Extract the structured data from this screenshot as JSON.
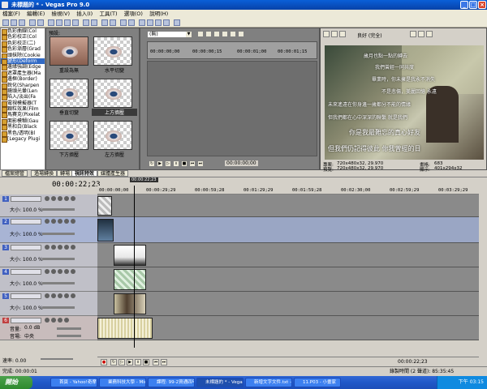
{
  "window": {
    "title": "未標題的 * - Vegas Pro 9.0"
  },
  "menu": [
    "檔案(F)",
    "編輯(E)",
    "檢視(V)",
    "插入(I)",
    "工具(T)",
    "選項(O)",
    "說明(H)"
  ],
  "fx_list": {
    "items": [
      "色彩曲線(Col",
      "色彩校正(Col",
      "色彩校正(二)",
      "色彩漸層(Grad",
      "頭抹除(Cookie",
      "變形(Deform",
      "邊緣強調(Edge",
      "遮罩產生器(Ma",
      "邊框(Border)",
      "銳化(Sharpen",
      "鏡頭光暈(Len",
      "陷入/淡出(Fa",
      "電視模擬器(T",
      "顆粒效果(Film",
      "馬賽克(Pixelat",
      "面影模糊(Gau",
      "黑和白(Black",
      "黑色/透明(Bl",
      "[Legacy Plugi"
    ],
    "selected_index": 5
  },
  "presets": {
    "header": "預設:",
    "items": [
      "重設為無",
      "水平切變",
      "垂直切變",
      "上方擠壓",
      "下方擠壓",
      "左方擠壓"
    ],
    "selected_index": 3
  },
  "trimmer": {
    "dropdown": "(無)",
    "ruler": [
      "00:00:00;00",
      "00:00:00;15",
      "00:00:01;00",
      "00:00:01;15"
    ],
    "time": "00:00:00;00"
  },
  "preview": {
    "quality": "良好 (完全)",
    "overlay_lines": [
      "歲月也點一點的轉去",
      "我們曾經一同共度",
      "畢業時，你未擁是我永不消失",
      "不是悲傷，美麗回憶 永遠",
      "未來遙遠在你身邊一歲都分不能的情緣",
      "但我們都在心中深深的聯繫 就是我們",
      "你是我最難忘的真心好友",
      "但我們仍記得彼此 你我曾經的日"
    ],
    "project_label": "專案:",
    "project_value": "720x480x32, 29.970",
    "preview_label": "預覽:",
    "preview_value": "720x480x32, 29.970",
    "frame_label": "畫格:",
    "frame_value": "683",
    "display_label": "顯示:",
    "display_value": "401x294x32"
  },
  "tabs": [
    "檔案總管",
    "過場轉換",
    "轉場",
    "視訊特效",
    "媒體產生器"
  ],
  "active_tab_index": 3,
  "timeline": {
    "timecode": "00:00:22;23",
    "marker": "00:00:22;23",
    "ruler": [
      "00:00:00;00",
      "00:00:29;29",
      "00:00:59;28",
      "00:01:29;29",
      "00:01:59;28",
      "00:02:30;00",
      "00:02:59;29",
      "00:03:29;29"
    ],
    "end_time": "00:00:22;23",
    "rate_label": "速率: 0.00"
  },
  "tracks": [
    {
      "num": "1",
      "label": "大小: 100.0 %",
      "type": "video"
    },
    {
      "num": "2",
      "label": "大小: 100.0 %",
      "type": "video"
    },
    {
      "num": "3",
      "label": "大小: 100.0 %",
      "type": "video"
    },
    {
      "num": "4",
      "label": "大小: 100.0 %",
      "type": "video"
    },
    {
      "num": "5",
      "label": "大小: 100.0 %",
      "type": "video"
    },
    {
      "num": "6",
      "label_vol": "音量:",
      "vol": "0.0 dB",
      "label_pan": "音場:",
      "pan": "中央",
      "type": "audio"
    }
  ],
  "status": {
    "left": "完成: 00:00:01",
    "right": "錄製時間 (2 聲道): 85:35:45"
  },
  "taskbar": {
    "start": "開始",
    "tasks": [
      "首頁 - Yahoo!奇摩...",
      "業務科技大學 - Mic...",
      "課程: 99-2資通四甲...",
      "未標題的 * - Vegas",
      "新增文字文件.txt -...",
      "11.P03 - 小畫家"
    ],
    "active_index": 3,
    "clock": "下午 03:15"
  }
}
